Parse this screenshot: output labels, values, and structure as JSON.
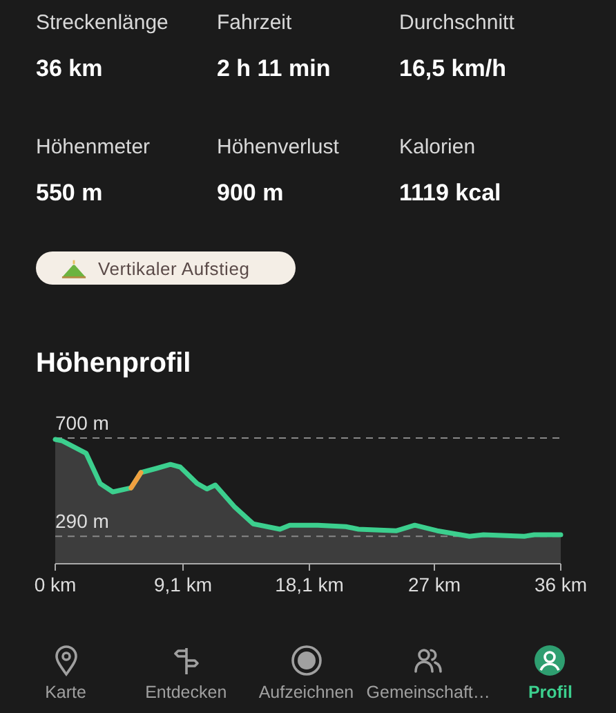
{
  "stats": [
    {
      "label": "Streckenlänge",
      "value": "36 km"
    },
    {
      "label": "Fahrzeit",
      "value": "2 h 11 min"
    },
    {
      "label": "Durchschnitt",
      "value": "16,5 km/h"
    },
    {
      "label": "Höhenmeter",
      "value": "550 m"
    },
    {
      "label": "Höhenverlust",
      "value": "900 m"
    },
    {
      "label": "Kalorien",
      "value": "1119 kcal"
    }
  ],
  "badge": {
    "label": "Vertikaler Aufstieg"
  },
  "profile": {
    "title": "Höhenprofil",
    "chart_data": {
      "type": "area",
      "x": [
        0,
        0.5,
        2.2,
        3.2,
        4.1,
        5.4,
        6.1,
        7.2,
        8.2,
        8.9,
        10.1,
        10.8,
        11.4,
        12.8,
        14.1,
        16.0,
        16.7,
        18.7,
        20.7,
        21.6,
        24.3,
        25.6,
        27.2,
        29.5,
        30.5,
        33.4,
        34.1,
        36
      ],
      "series": [
        {
          "color": "#3ccf8e",
          "values": [
            694,
            688,
            636,
            510,
            475,
            492,
            556,
            573,
            590,
            579,
            510,
            487,
            504,
            411,
            342,
            319,
            336,
            336,
            330,
            319,
            313,
            336,
            313,
            290,
            296,
            290,
            296,
            296
          ]
        },
        {
          "type": "line",
          "color": "#f0a040",
          "values": [
            null,
            null,
            null,
            null,
            null,
            492,
            556,
            null,
            null,
            null,
            null,
            null,
            null,
            null,
            null,
            null,
            null,
            null,
            null,
            null,
            null,
            null,
            null,
            null,
            null,
            null,
            null,
            null
          ]
        }
      ],
      "xlim": [
        0,
        36
      ],
      "ylim": [
        175,
        700
      ],
      "xticks": [
        {
          "value": 0,
          "label": "0 km"
        },
        {
          "value": 9.1,
          "label": "9,1 km"
        },
        {
          "value": 18.1,
          "label": "18,1 km"
        },
        {
          "value": 27,
          "label": "27 km"
        },
        {
          "value": 36,
          "label": "36 km"
        }
      ],
      "ref_lines": [
        {
          "axis": "y",
          "value": 700,
          "label": "700 m"
        },
        {
          "axis": "y",
          "value": 290,
          "label": "290 m"
        }
      ]
    }
  },
  "nav": [
    {
      "label": "Karte",
      "kind": "pin",
      "selected": false
    },
    {
      "label": "Entdecken",
      "kind": "signpost",
      "selected": false
    },
    {
      "label": "Aufzeichnen",
      "kind": "record",
      "selected": false
    },
    {
      "label": "Gemeinschaft…",
      "kind": "people",
      "selected": false
    },
    {
      "label": "Profil",
      "kind": "profile",
      "selected": true
    }
  ]
}
